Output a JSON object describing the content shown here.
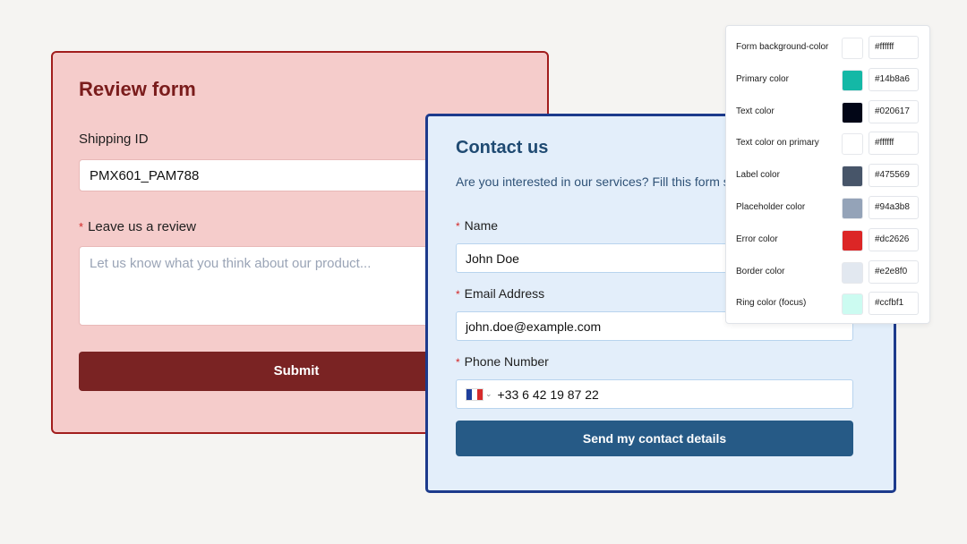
{
  "review_form": {
    "title": "Review form",
    "shipping_label": "Shipping ID",
    "shipping_value": "PMX601_PAM788",
    "review_label": "Leave us a review",
    "review_placeholder": "Let us know what you think about our product...",
    "submit_label": "Submit",
    "required_mark": "*"
  },
  "contact_form": {
    "title": "Contact us",
    "description": "Are you interested in our services? Fill this form soon as possible!",
    "name_label": "Name",
    "name_value": "John Doe",
    "email_label": "Email Address",
    "email_value": "john.doe@example.com",
    "phone_label": "Phone Number",
    "phone_value": "+33 6 42 19 87 22",
    "phone_flag": "flag-france-icon",
    "submit_label": "Send my contact details",
    "required_mark": "*"
  },
  "theme": [
    {
      "label": "Form background-color",
      "hex": "#ffffff"
    },
    {
      "label": "Primary color",
      "hex": "#14b8a6"
    },
    {
      "label": "Text color",
      "hex": "#020617"
    },
    {
      "label": "Text color on primary",
      "hex": "#ffffff"
    },
    {
      "label": "Label color",
      "hex": "#475569"
    },
    {
      "label": "Placeholder color",
      "hex": "#94a3b8"
    },
    {
      "label": "Error color",
      "hex": "#dc2626"
    },
    {
      "label": "Border color",
      "hex": "#e2e8f0"
    },
    {
      "label": "Ring color (focus)",
      "hex": "#ccfbf1"
    }
  ],
  "colors": {
    "review_bg": "#f5cccb",
    "review_accent": "#7a2323",
    "contact_bg": "#e3eefa",
    "contact_accent": "#265a86"
  }
}
